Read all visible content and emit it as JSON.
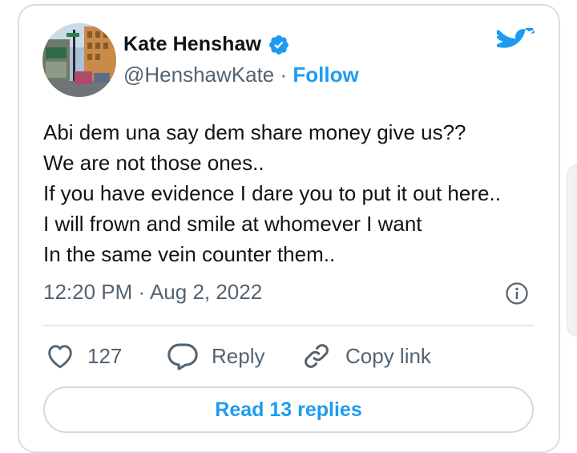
{
  "author": {
    "name": "Kate Henshaw",
    "handle": "@HenshawKate",
    "separator": " · ",
    "follow_label": "Follow"
  },
  "tweet": {
    "lines": [
      "Abi dem una say dem share money give us??",
      "We are not those ones..",
      "If you have evidence I dare you to put it out here..",
      "I will frown and smile at whomever I want",
      "In the same vein counter them.."
    ],
    "timestamp": "12:20 PM · Aug 2, 2022"
  },
  "actions": {
    "like_count": "127",
    "reply_label": "Reply",
    "copy_label": "Copy link"
  },
  "footer": {
    "read_replies_label": "Read 13 replies"
  },
  "icons": {
    "brand": "twitter-bird-icon",
    "verified": "verified-badge-icon",
    "info": "info-icon",
    "like": "heart-icon",
    "reply": "reply-bubble-icon",
    "copy": "link-icon"
  },
  "colors": {
    "accent": "#1d9bf0",
    "text_primary": "#0f1419",
    "text_secondary": "#536471",
    "border": "#cfd9de"
  }
}
